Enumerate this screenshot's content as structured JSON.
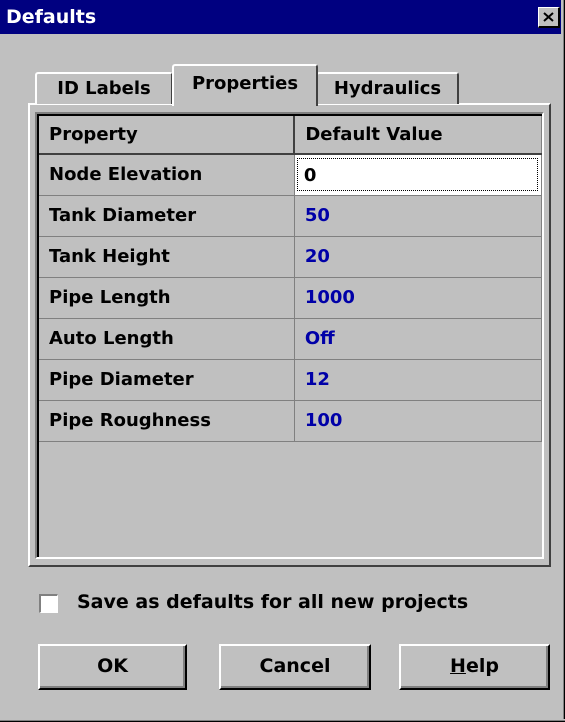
{
  "window": {
    "title": "Defaults"
  },
  "tabs": [
    {
      "label": "ID Labels"
    },
    {
      "label": "Properties"
    },
    {
      "label": "Hydraulics"
    }
  ],
  "table": {
    "headers": [
      "Property",
      "Default Value"
    ],
    "rows": [
      {
        "property": "Node Elevation",
        "value": "0"
      },
      {
        "property": "Tank Diameter",
        "value": "50"
      },
      {
        "property": "Tank Height",
        "value": "20"
      },
      {
        "property": "Pipe Length",
        "value": "1000"
      },
      {
        "property": "Auto Length",
        "value": "Off"
      },
      {
        "property": "Pipe Diameter",
        "value": "12"
      },
      {
        "property": "Pipe Roughness",
        "value": "100"
      }
    ]
  },
  "save_defaults": {
    "label": "Save as defaults for all new projects",
    "checked": false
  },
  "buttons": {
    "ok": "OK",
    "cancel": "Cancel",
    "help_prefix": "H",
    "help_rest": "elp"
  },
  "colors": {
    "titlebar": "#000080",
    "value_text": "#0000a8",
    "face": "#c0c0c0"
  },
  "icons": {
    "close": "close-icon"
  }
}
